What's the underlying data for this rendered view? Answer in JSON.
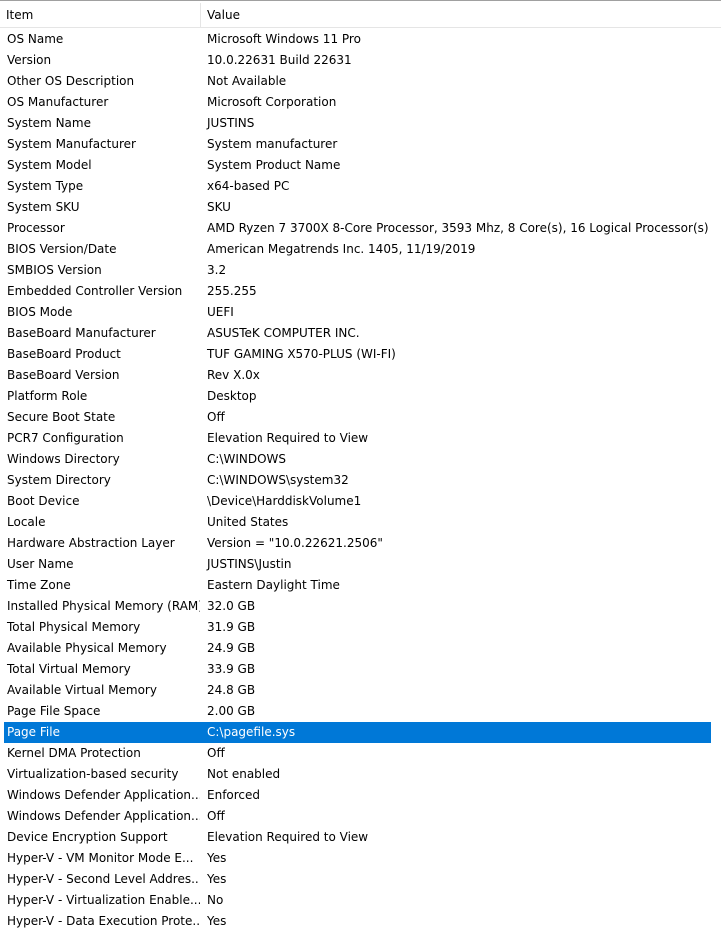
{
  "header": {
    "item": "Item",
    "value": "Value"
  },
  "rows": [
    {
      "item": "OS Name",
      "value": "Microsoft Windows 11 Pro"
    },
    {
      "item": "Version",
      "value": "10.0.22631 Build 22631"
    },
    {
      "item": "Other OS Description",
      "value": "Not Available"
    },
    {
      "item": "OS Manufacturer",
      "value": "Microsoft Corporation"
    },
    {
      "item": "System Name",
      "value": "JUSTINS"
    },
    {
      "item": "System Manufacturer",
      "value": "System manufacturer"
    },
    {
      "item": "System Model",
      "value": "System Product Name"
    },
    {
      "item": "System Type",
      "value": "x64-based PC"
    },
    {
      "item": "System SKU",
      "value": "SKU"
    },
    {
      "item": "Processor",
      "value": "AMD Ryzen 7 3700X 8-Core Processor, 3593 Mhz, 8 Core(s), 16 Logical Processor(s)"
    },
    {
      "item": "BIOS Version/Date",
      "value": "American Megatrends Inc. 1405, 11/19/2019"
    },
    {
      "item": "SMBIOS Version",
      "value": "3.2"
    },
    {
      "item": "Embedded Controller Version",
      "value": "255.255"
    },
    {
      "item": "BIOS Mode",
      "value": "UEFI"
    },
    {
      "item": "BaseBoard Manufacturer",
      "value": "ASUSTeK COMPUTER INC."
    },
    {
      "item": "BaseBoard Product",
      "value": "TUF GAMING X570-PLUS (WI-FI)"
    },
    {
      "item": "BaseBoard Version",
      "value": "Rev X.0x"
    },
    {
      "item": "Platform Role",
      "value": "Desktop"
    },
    {
      "item": "Secure Boot State",
      "value": "Off"
    },
    {
      "item": "PCR7 Configuration",
      "value": "Elevation Required to View"
    },
    {
      "item": "Windows Directory",
      "value": "C:\\WINDOWS"
    },
    {
      "item": "System Directory",
      "value": "C:\\WINDOWS\\system32"
    },
    {
      "item": "Boot Device",
      "value": "\\Device\\HarddiskVolume1"
    },
    {
      "item": "Locale",
      "value": "United States"
    },
    {
      "item": "Hardware Abstraction Layer",
      "value": "Version = \"10.0.22621.2506\""
    },
    {
      "item": "User Name",
      "value": "JUSTINS\\Justin"
    },
    {
      "item": "Time Zone",
      "value": "Eastern Daylight Time"
    },
    {
      "item": "Installed Physical Memory (RAM)",
      "value": "32.0 GB"
    },
    {
      "item": "Total Physical Memory",
      "value": "31.9 GB"
    },
    {
      "item": "Available Physical Memory",
      "value": "24.9 GB"
    },
    {
      "item": "Total Virtual Memory",
      "value": "33.9 GB"
    },
    {
      "item": "Available Virtual Memory",
      "value": "24.8 GB"
    },
    {
      "item": "Page File Space",
      "value": "2.00 GB"
    },
    {
      "item": "Page File",
      "value": "C:\\pagefile.sys",
      "selected": true
    },
    {
      "item": "Kernel DMA Protection",
      "value": "Off"
    },
    {
      "item": "Virtualization-based security",
      "value": "Not enabled"
    },
    {
      "item": "Windows Defender Application...",
      "value": "Enforced"
    },
    {
      "item": "Windows Defender Application...",
      "value": "Off"
    },
    {
      "item": "Device Encryption Support",
      "value": "Elevation Required to View"
    },
    {
      "item": "Hyper-V - VM Monitor Mode E...",
      "value": "Yes"
    },
    {
      "item": "Hyper-V - Second Level Addres...",
      "value": "Yes"
    },
    {
      "item": "Hyper-V - Virtualization Enable...",
      "value": "No"
    },
    {
      "item": "Hyper-V - Data Execution Prote...",
      "value": "Yes"
    }
  ],
  "colors": {
    "selection": "#0078d7",
    "selection_text": "#ffffff"
  }
}
